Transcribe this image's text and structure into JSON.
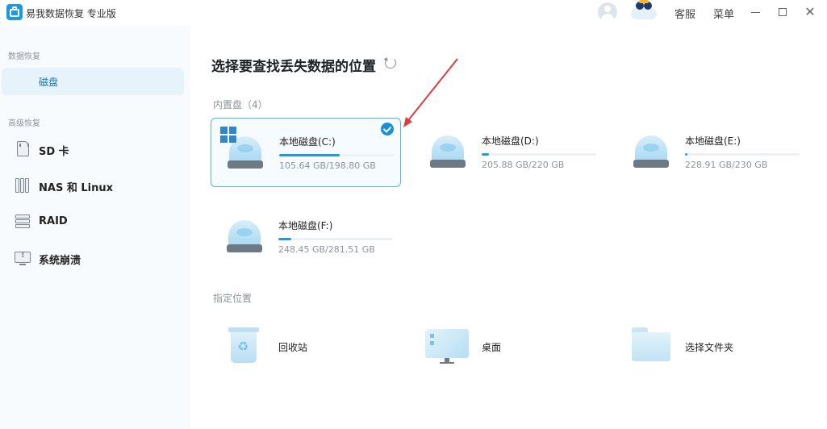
{
  "app": {
    "title": "易我数据恢复 专业版"
  },
  "titlebar": {
    "service_label": "客服",
    "menu_label": "菜单",
    "minimize_icon": "minimize-icon",
    "maximize_icon": "maximize-icon",
    "close_icon": "close-icon"
  },
  "sidebar": {
    "section_recovery": "数据恢复",
    "section_advanced": "高级恢复",
    "items": [
      {
        "label": "磁盘",
        "icon": "disk-icon",
        "active": true
      },
      {
        "label": "SD 卡",
        "icon": "sd-card-icon"
      },
      {
        "label": "NAS 和 Linux",
        "icon": "nas-icon"
      },
      {
        "label": "RAID",
        "icon": "raid-icon"
      },
      {
        "label": "系统崩溃",
        "icon": "system-crash-icon"
      }
    ]
  },
  "main": {
    "title": "选择要查找丢失数据的位置",
    "internal_label": "内置盘（4）",
    "locations_label": "指定位置",
    "disks": [
      {
        "name": "本地磁盘(C:)",
        "size": "105.64 GB/198.80 GB",
        "used_fraction": 0.53,
        "selected": true,
        "system": true
      },
      {
        "name": "本地磁盘(D:)",
        "size": "205.88 GB/220 GB",
        "used_fraction": 0.06,
        "selected": false
      },
      {
        "name": "本地磁盘(E:)",
        "size": "228.91 GB/230 GB",
        "used_fraction": 0.02,
        "selected": false
      },
      {
        "name": "本地磁盘(F:)",
        "size": "248.45 GB/281.51 GB",
        "used_fraction": 0.11,
        "selected": false
      }
    ],
    "locations": [
      {
        "label": "回收站",
        "icon": "recycle-bin-icon"
      },
      {
        "label": "桌面",
        "icon": "desktop-icon"
      },
      {
        "label": "选择文件夹",
        "icon": "folder-icon"
      }
    ]
  },
  "colors": {
    "accent": "#1a9be0",
    "selected_border": "#56b6e6",
    "annotation_arrow": "#e03c3c"
  }
}
